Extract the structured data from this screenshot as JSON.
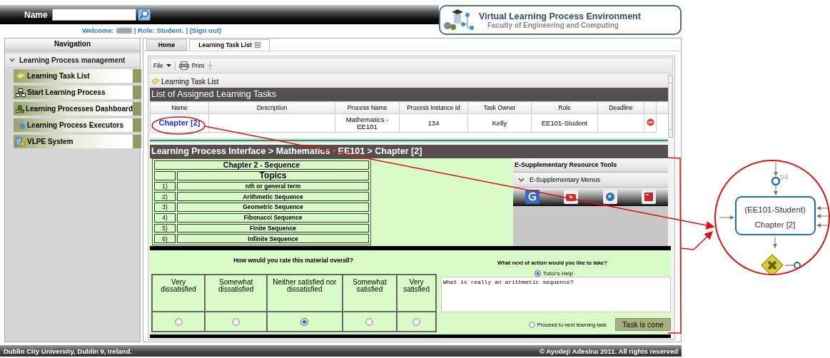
{
  "header": {
    "search_label": "Name",
    "welcome_label": "Welcome:",
    "role": "| Role: Student.",
    "sign_out": "| (Sign out)"
  },
  "logo": {
    "title": "Virtual Learning Process Environment",
    "subtitle": "Faculty of Engineering and Computing"
  },
  "navigation": {
    "title": "Navigation",
    "group": {
      "label": "Learning Process management",
      "expanded": true,
      "items": [
        {
          "label": "Learning Task List",
          "kind": "note"
        },
        {
          "label": "Start Learning Process",
          "kind": "network"
        },
        {
          "label": "Learning Processes Dashboard",
          "kind": "dashboard"
        },
        {
          "label": "Learning Process Executors",
          "kind": "executors"
        },
        {
          "label": "VLPE System",
          "kind": "system"
        }
      ]
    }
  },
  "tabs": [
    {
      "label": "Home",
      "selected": false,
      "closable": false
    },
    {
      "label": "Learning Task List",
      "selected": true,
      "closable": true
    }
  ],
  "toolbar": [
    {
      "label": "File",
      "kind": "menu"
    },
    {
      "label": "Print",
      "kind": "print"
    }
  ],
  "panel": {
    "title": "Learning Task List",
    "table": {
      "title": "List of Assigned Learning Tasks",
      "columns": [
        "Name",
        "Description",
        "Process Name",
        "Process Instance Id",
        "Task Owner",
        "Role",
        "Deadline"
      ],
      "rows": [
        {
          "cells": [
            "Chapter [2]",
            null,
            "Mathematics - EE101",
            "134",
            "Kelly",
            "EE101-Student",
            null
          ]
        }
      ]
    }
  },
  "interface": {
    "breadcrumb": "Learning Process Interface > Mathematics - EE101 > Chapter [2]",
    "topics": {
      "title": "Chapter 2 - Sequence",
      "heading": "Topics",
      "rows": [
        {
          "number": "1)",
          "topic": "nth or general term"
        },
        {
          "number": "2)",
          "topic": "Arithmetic Sequence"
        },
        {
          "number": "3)",
          "topic": "Geometric Sequence"
        },
        {
          "number": "4)",
          "topic": "Fibonacci Sequence"
        },
        {
          "number": "5)",
          "topic": "Finite Sequence"
        },
        {
          "number": "6)",
          "topic": "Infinite Sequence"
        }
      ]
    },
    "resources": {
      "title": "E-Supplementary Resource Tools",
      "menu": {
        "label": "E-Supplementary Menus",
        "expanded": true
      },
      "tools": [
        {
          "kind": "arc"
        },
        {
          "kind": "play"
        },
        {
          "kind": "globe"
        },
        {
          "kind": "book"
        }
      ]
    }
  },
  "rating": {
    "question": "How would you rate this material overall?",
    "options": [
      {
        "label": "Very dissatisfied",
        "selected": false
      },
      {
        "label": "Somewhat dissatisfied",
        "selected": false
      },
      {
        "label": "Neither satisfied nor dissatisfied",
        "selected": true
      },
      {
        "label": "Somewhat satisfied",
        "selected": false
      },
      {
        "label": "Very satisfied",
        "selected": false
      }
    ]
  },
  "next_action": {
    "question": "What next of action would you like to take?",
    "options": [
      {
        "label": "Tutor's Help",
        "selected": true
      },
      {
        "label": "Proceed to next learning task",
        "selected": false
      }
    ],
    "message": "What is really an arithmetic sequence?",
    "button": "Task is cone"
  },
  "footer": {
    "left": "Dublin City University, Dublin 9, Ireland.",
    "right": "© Ayodeji Adesina 2011. All rights reserved"
  },
  "callout": {
    "role": "(EE101-Student)",
    "task": "Chapter [2]",
    "flow_label": "tr4"
  }
}
